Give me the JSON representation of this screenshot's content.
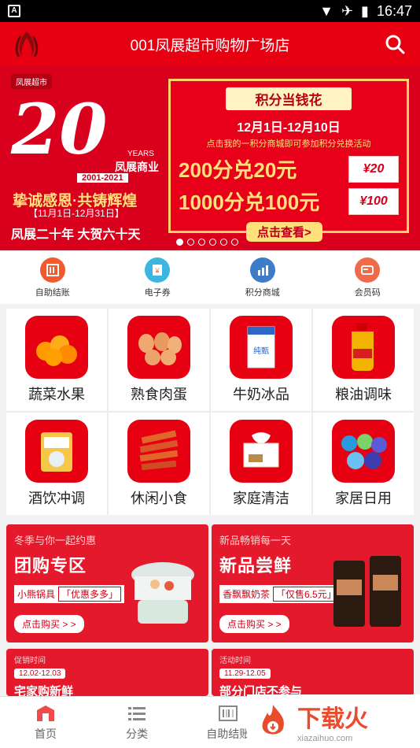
{
  "status": {
    "time": "16:47",
    "left_icon": "A"
  },
  "appbar": {
    "title": "001凤展超市购物广场店"
  },
  "banner": {
    "brand_small": "凤展超市",
    "big_number": "20",
    "years": "YEARS",
    "company": "凤展商业",
    "range": "2001-2021",
    "slogan": "挚诚感恩·共铸辉煌",
    "date": "【11月1日-12月31日】",
    "celebrate": "凤展二十年 大贺六十天",
    "right": {
      "title": "积分当钱花",
      "date": "12月1日-12月10日",
      "sub": "点击我的一积分商城即可参加积分兑换活动",
      "rows": [
        {
          "text": "200分兑20元",
          "coupon": "20"
        },
        {
          "text": "1000分兑100元",
          "coupon": "100"
        }
      ],
      "button": "点击查看>"
    },
    "dots": 6,
    "active_dot": 0
  },
  "quick": [
    {
      "label": "自助结账",
      "icon": "scan-icon",
      "color": "#f05a2e"
    },
    {
      "label": "电子券",
      "icon": "coupon-icon",
      "color": "#3bb6e0"
    },
    {
      "label": "积分商城",
      "icon": "chart-icon",
      "color": "#3c7cc9"
    },
    {
      "label": "会员码",
      "icon": "card-icon",
      "color": "#f06a4a"
    }
  ],
  "categories": [
    {
      "label": "蔬菜水果",
      "icon": "fruit-icon"
    },
    {
      "label": "熟食肉蛋",
      "icon": "egg-icon"
    },
    {
      "label": "牛奶冰品",
      "icon": "milk-icon"
    },
    {
      "label": "粮油调味",
      "icon": "oil-icon"
    },
    {
      "label": "酒饮冲调",
      "icon": "drink-icon"
    },
    {
      "label": "休闲小食",
      "icon": "snack-icon"
    },
    {
      "label": "家庭清洁",
      "icon": "tissue-icon"
    },
    {
      "label": "家居日用",
      "icon": "bag-icon"
    }
  ],
  "promos": [
    {
      "small": "冬季与你一起约惠",
      "big": "团购专区",
      "tag": "小熊锅具",
      "hl": "「优惠多多」",
      "buy": "点击购买 > >"
    },
    {
      "small": "新品畅销每一天",
      "big": "新品尝鲜",
      "tag": "香飘飘奶茶",
      "hl": "「仅售6.5元」",
      "buy": "点击购买 > >"
    }
  ],
  "promos2": [
    {
      "date_label": "促销时间",
      "date": "12.02-12.03",
      "title": "宅家购新鲜"
    },
    {
      "date_label": "活动时间",
      "date": "11.29-12.05",
      "title": "部分门店不参与"
    }
  ],
  "tabs": [
    {
      "label": "首页",
      "icon": "home-icon"
    },
    {
      "label": "分类",
      "icon": "list-icon"
    },
    {
      "label": "自助结账",
      "icon": "barcode-icon"
    }
  ],
  "watermark": {
    "big": "下载火",
    "small": "xiazaihuo.com"
  }
}
